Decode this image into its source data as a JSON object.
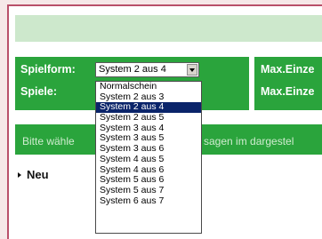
{
  "form": {
    "spielform_label": "Spielform:",
    "spiele_label": "Spiele:",
    "selected_value": "System 2 aus 4",
    "max_label_1": "Max.Einze",
    "max_label_2": "Max.Einze"
  },
  "info": {
    "text_left": "Bitte wähle",
    "text_right": "sagen im dargestel"
  },
  "neu_label": "Neu",
  "dropdown": {
    "options": [
      "Normalschein",
      "System 2 aus 3",
      "System 2 aus 4",
      "System 2 aus 5",
      "System 3 aus 4",
      "System 3 aus 5",
      "System 3 aus 6",
      "System 4 aus 5",
      "System 4 aus 6",
      "System 5 aus 6",
      "System 5 aus 7",
      "System 6 aus 7"
    ],
    "selected_index": 2
  },
  "colors": {
    "panel_green": "#2aa43c",
    "top_bar": "#cde8cc",
    "frame_border": "#b9506a",
    "selection": "#0a246a"
  }
}
